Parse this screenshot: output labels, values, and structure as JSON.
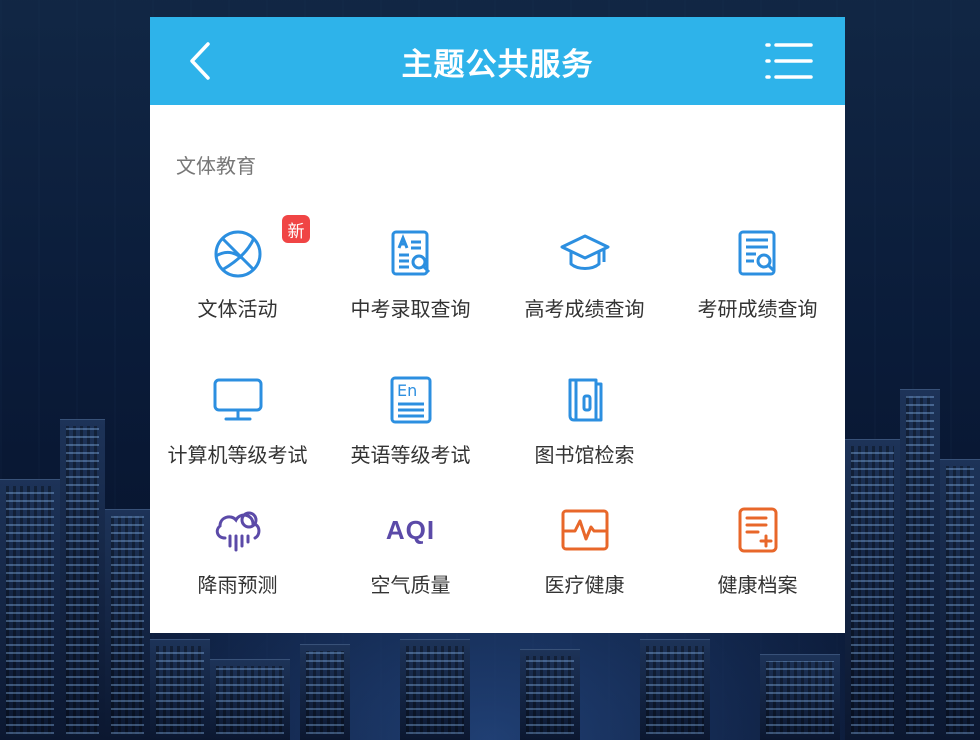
{
  "header": {
    "title": "主题公共服务",
    "back_icon": "chevron-left-icon",
    "menu_icon": "list-menu-icon"
  },
  "section": {
    "title": "文体教育"
  },
  "items": [
    {
      "label": "文体活动",
      "icon": "basketball-icon",
      "badge": "新"
    },
    {
      "label": "中考录取查询",
      "icon": "document-search-icon"
    },
    {
      "label": "高考成绩查询",
      "icon": "graduation-cap-icon"
    },
    {
      "label": "考研成绩查询",
      "icon": "report-search-icon"
    },
    {
      "label": "计算机等级考试",
      "icon": "monitor-icon"
    },
    {
      "label": "英语等级考试",
      "icon": "english-book-icon"
    },
    {
      "label": "图书馆检索",
      "icon": "library-book-icon"
    },
    {
      "label": "降雨预测",
      "icon": "rain-cloud-icon"
    },
    {
      "label": "空气质量",
      "icon": "aqi-icon",
      "icon_text": "AQI"
    },
    {
      "label": "医疗健康",
      "icon": "heartbeat-monitor-icon"
    },
    {
      "label": "健康档案",
      "icon": "health-record-icon"
    }
  ],
  "colors": {
    "header_bg": "#2eb3ea",
    "icon_blue": "#2c8fe0",
    "icon_purple": "#5b4aa8",
    "icon_orange": "#e8672a",
    "badge_red": "#f04545"
  }
}
